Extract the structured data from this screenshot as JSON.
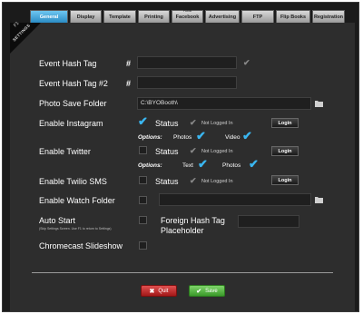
{
  "tabs": [
    {
      "label": "General",
      "active": true
    },
    {
      "label": "Display"
    },
    {
      "label": "Template"
    },
    {
      "label": "Printing"
    },
    {
      "label": "Facebook",
      "badge": "Public"
    },
    {
      "label": "Advertising"
    },
    {
      "label": "FTP"
    },
    {
      "label": "Flip Books"
    },
    {
      "label": "Registration"
    }
  ],
  "corner": {
    "f1": "F1",
    "text": "SETTINGS"
  },
  "fields": {
    "event_hash_tag": {
      "label": "Event Hash Tag",
      "hash": "#",
      "value": ""
    },
    "event_hash_tag_2": {
      "label": "Event Hash Tag #2",
      "hash": "#",
      "value": ""
    },
    "photo_save_folder": {
      "label": "Photo Save Folder",
      "value": "C:\\BYOBooth\\"
    },
    "instagram": {
      "label": "Enable Instagram",
      "status_label": "Status",
      "status_text": "Not Logged In",
      "login_label": "Login",
      "options_label": "Options:",
      "photos_label": "Photos",
      "video_label": "Video"
    },
    "twitter": {
      "label": "Enable Twitter",
      "status_label": "Status",
      "status_text": "Not Logged In",
      "login_label": "Login",
      "options_label": "Options:",
      "text_label": "Text",
      "photos_label": "Photos"
    },
    "twilio": {
      "label": "Enable Twilio SMS",
      "status_label": "Status",
      "status_text": "Not Logged In",
      "login_label": "Login"
    },
    "watch_folder": {
      "label": "Enable Watch Folder",
      "value": ""
    },
    "auto_start": {
      "label": "Auto Start",
      "sub": "(Skip Settings Screen. Use F1 to return to Settings)"
    },
    "foreign_hash": {
      "label_line1": "Foreign Hash Tag",
      "label_line2": "Placeholder",
      "value": ""
    },
    "chromecast": {
      "label": "Chromecast Slideshow"
    }
  },
  "actions": {
    "quit_label": "Quit",
    "save_label": "Save"
  },
  "colors": {
    "accent": "#3ab6f0",
    "quit": "#c62d2d",
    "save": "#5cbf46"
  }
}
